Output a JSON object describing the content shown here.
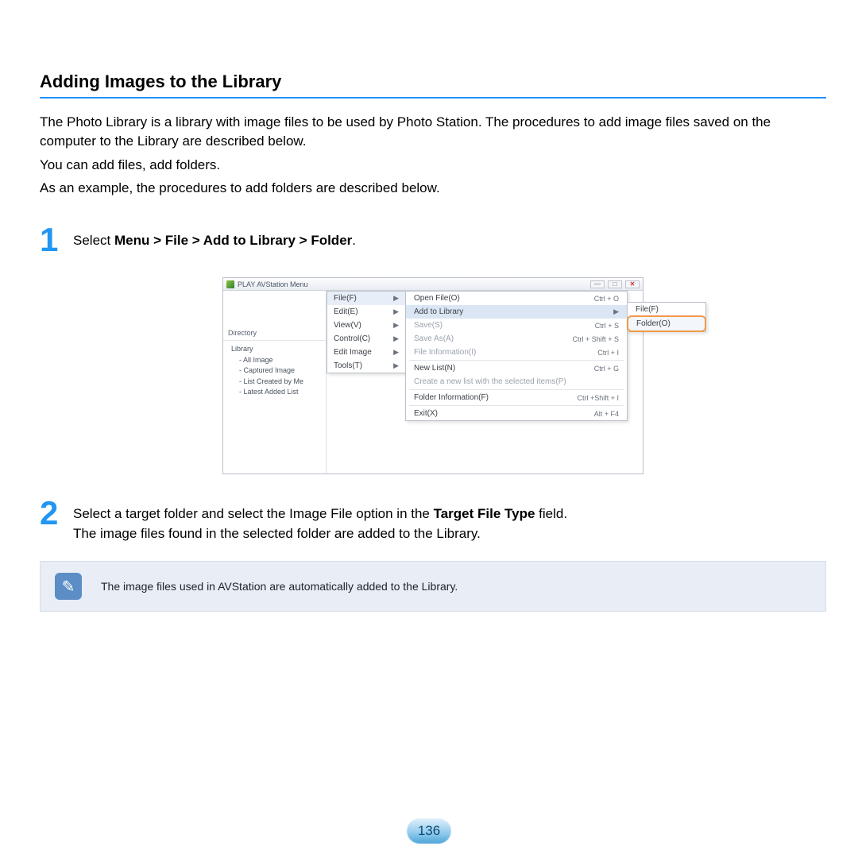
{
  "title": "Adding Images to the Library",
  "intro": {
    "p1": "The Photo Library is a library with image files to be used by Photo Station. The procedures to add image files saved on the computer to the Library are described below.",
    "p2": "You can add files, add folders.",
    "p3": "As an example, the procedures to add folders are described below."
  },
  "step1": {
    "num": "1",
    "lead": "Select ",
    "bold": "Menu > File > Add to Library > Folder",
    "trail": "."
  },
  "screenshot": {
    "window_title": "PLAY AVStation  Menu",
    "win_min": "—",
    "win_max": "□",
    "win_close": "✕",
    "sidebar": {
      "directory_label": "Directory",
      "root": "Library",
      "items": [
        "- All Image",
        "- Captured Image",
        "- List Created by Me",
        "- Latest Added List"
      ]
    },
    "menu1": [
      {
        "label": "File(F)",
        "highlight": true
      },
      {
        "label": "Edit(E)"
      },
      {
        "label": "View(V)"
      },
      {
        "label": "Control(C)"
      },
      {
        "label": "Edit Image"
      },
      {
        "label": "Tools(T)"
      }
    ],
    "menu2": [
      {
        "label": "Open File(O)",
        "shortcut": "Ctrl + O"
      },
      {
        "label": "Add to Library",
        "arrow": true,
        "highlight": true
      },
      {
        "label": "Save(S)",
        "shortcut": "Ctrl + S",
        "disabled": true
      },
      {
        "label": "Save As(A)",
        "shortcut": "Ctrl + Shift + S",
        "disabled": true
      },
      {
        "label": "File Information(I)",
        "shortcut": "Ctrl + I",
        "disabled": true
      },
      {
        "sep": true
      },
      {
        "label": "New List(N)",
        "shortcut": "Ctrl + G"
      },
      {
        "label": "Create a new list with the selected items(P)",
        "disabled": true
      },
      {
        "sep": true
      },
      {
        "label": "Folder Information(F)",
        "shortcut": "Ctrl +Shift + I"
      },
      {
        "sep": true
      },
      {
        "label": "Exit(X)",
        "shortcut": "Alt + F4"
      }
    ],
    "menu3": [
      {
        "label": "File(F)"
      },
      {
        "label": "Folder(O)",
        "highlight": true
      }
    ]
  },
  "step2": {
    "num": "2",
    "line1_a": "Select a target folder and select the Image File option in the ",
    "line1_bold": "Target File Type",
    "line1_b": " field.",
    "line2": "The image files found in the selected folder are added to the Library."
  },
  "note": {
    "icon_glyph": "✎",
    "text": "The image files used in AVStation are automatically added to the Library."
  },
  "page_number": "136"
}
